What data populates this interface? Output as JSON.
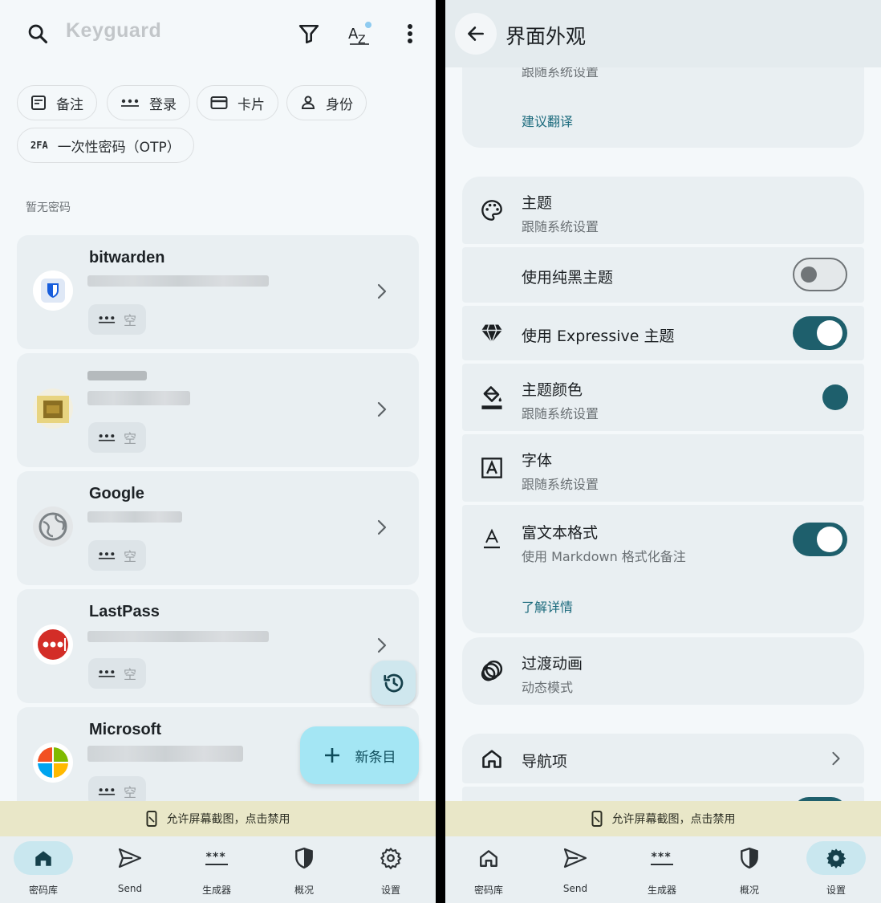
{
  "left": {
    "search": {
      "placeholder": "Keyguard"
    },
    "chips": [
      {
        "label": "备注",
        "icon": "note-icon"
      },
      {
        "label": "登录",
        "icon": "password-dots-icon"
      },
      {
        "label": "卡片",
        "icon": "credit-card-icon"
      },
      {
        "label": "身份",
        "icon": "person-icon"
      },
      {
        "label": "一次性密码（OTP）",
        "icon": "two-fa-icon",
        "badge": "2FA"
      }
    ],
    "section_label": "暂无密码",
    "items": [
      {
        "name": "bitwarden",
        "field": "空",
        "icon": "bitwarden-shield-icon"
      },
      {
        "name": "",
        "field": "空",
        "icon": "blurred-logo-icon"
      },
      {
        "name": "Google",
        "field": "空",
        "icon": "globe-icon"
      },
      {
        "name": "LastPass",
        "field": "空",
        "icon": "lastpass-dots-icon"
      },
      {
        "name": "Microsoft",
        "field": "空",
        "icon": "microsoft-logo-icon"
      }
    ],
    "fab_new_label": "新条目",
    "banner": "允许屏幕截图，点击禁用",
    "nav": [
      {
        "label": "密码库",
        "icon": "home-icon",
        "active": true
      },
      {
        "label": "Send",
        "icon": "send-icon",
        "active": false
      },
      {
        "label": "生成器",
        "icon": "generator-icon",
        "active": false
      },
      {
        "label": "概况",
        "icon": "shield-icon",
        "active": false
      },
      {
        "label": "设置",
        "icon": "gear-icon",
        "active": false
      }
    ]
  },
  "right": {
    "title": "界面外观",
    "partial_sub": "跟随系统设置",
    "suggest_translation": "建议翻译",
    "rows": {
      "theme": {
        "title": "主题",
        "sub": "跟随系统设置"
      },
      "black_theme": {
        "title": "使用纯黑主题",
        "on": false
      },
      "expressive": {
        "title": "使用 Expressive 主题",
        "on": true
      },
      "theme_color": {
        "title": "主题颜色",
        "sub": "跟随系统设置",
        "color": "#1e5f6c"
      },
      "font": {
        "title": "字体",
        "sub": "跟随系统设置"
      },
      "rich_text": {
        "title": "富文本格式",
        "sub": "使用 Markdown 格式化备注",
        "on": true,
        "link": "了解详情"
      },
      "animation": {
        "title": "过渡动画",
        "sub": "动态模式"
      },
      "nav_items": {
        "title": "导航项"
      }
    },
    "banner": "允许屏幕截图，点击禁用",
    "nav": [
      {
        "label": "密码库",
        "icon": "home-outline-icon",
        "active": false
      },
      {
        "label": "Send",
        "icon": "send-icon",
        "active": false
      },
      {
        "label": "生成器",
        "icon": "generator-icon",
        "active": false
      },
      {
        "label": "概况",
        "icon": "shield-icon",
        "active": false
      },
      {
        "label": "设置",
        "icon": "gear-icon",
        "active": true
      }
    ]
  },
  "colors": {
    "accent": "#1e5f6c",
    "active_nav": "#c9e7ef",
    "fab": "#a4e6f4",
    "banner": "#e9e7c8"
  }
}
